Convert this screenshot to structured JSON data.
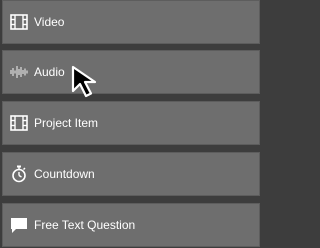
{
  "items": [
    {
      "label": "Video",
      "icon": "film-icon"
    },
    {
      "label": "Audio",
      "icon": "audio-waveform-icon"
    },
    {
      "label": "Project Item",
      "icon": "film-icon"
    },
    {
      "label": "Countdown",
      "icon": "stopwatch-icon"
    },
    {
      "label": "Free Text Question",
      "icon": "speech-bubble-icon"
    }
  ],
  "colors": {
    "background": "#3d3d3d",
    "item_bg": "#6e6e6e",
    "item_border": "#5d5d5d",
    "text": "#ffffff"
  }
}
